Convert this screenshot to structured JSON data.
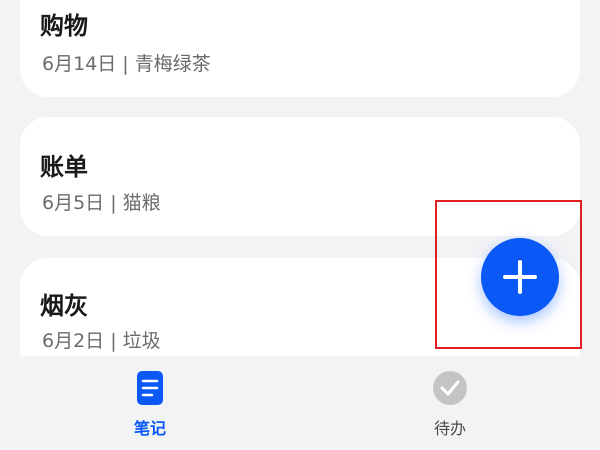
{
  "notes": [
    {
      "title": "购物",
      "meta": "6月14日 | 青梅绿茶"
    },
    {
      "title": "账单",
      "meta": "6月5日 | 猫粮"
    },
    {
      "title": "烟灰",
      "meta": "6月2日 | 垃圾"
    }
  ],
  "fab": {
    "icon": "plus-icon",
    "color": "#0a59f7"
  },
  "bottom_nav": {
    "items": [
      {
        "label": "笔记",
        "icon": "notes-icon",
        "active": true,
        "color": "#0a59f7"
      },
      {
        "label": "待办",
        "icon": "checkmark-circle-icon",
        "active": false,
        "color": "#4a4a4a"
      }
    ]
  },
  "colors": {
    "background": "#f1f3f5",
    "card": "#ffffff",
    "accent": "#0a59f7",
    "highlight": "#e02020"
  }
}
